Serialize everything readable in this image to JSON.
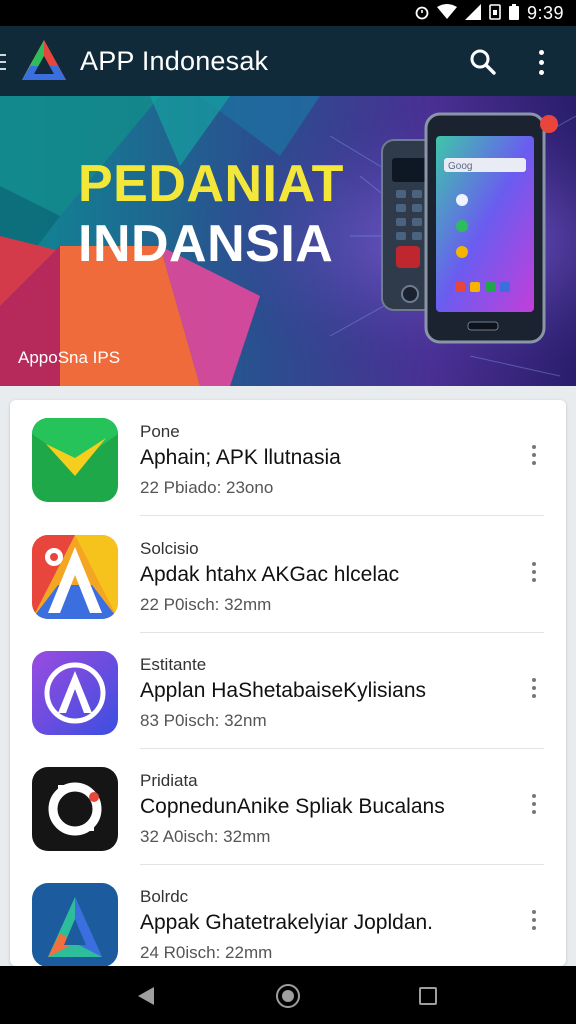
{
  "status_bar": {
    "time": "9:39"
  },
  "app_bar": {
    "title": "APP Indonesak"
  },
  "banner": {
    "headline_line1": "PEDANIAT",
    "headline_line2": "INDANSIA",
    "caption": "AppoSna IPS",
    "phone_screen_label": "Goog"
  },
  "apps": [
    {
      "category": "Pone",
      "title": "Aphain; APK llutnasia",
      "meta": "22 Pbiado: 23ono",
      "icon": "green-check-app-icon",
      "color": "#1ea84a"
    },
    {
      "category": "Solcisio",
      "title": "Apdak htahx AKGac hlcelac",
      "meta": "22 P0isch: 32mm",
      "icon": "colorful-a-app-icon",
      "color": "#e8453c"
    },
    {
      "category": "Estitante",
      "title": "Applan HaShetabaiseKylisians",
      "meta": "83 P0isch: 32nm",
      "icon": "compass-a-app-icon",
      "color": "#5b4bd9"
    },
    {
      "category": "Pridiata",
      "title": "CopnedunAnike Spliak Bucalans",
      "meta": "32 A0isch: 32mm",
      "icon": "camera-ring-app-icon",
      "color": "#151515"
    },
    {
      "category": "Bolrdc",
      "title": "Appak Ghatetrakelyiar Jopldan.",
      "meta": "24 R0isch: 22mm",
      "icon": "blue-a-app-icon",
      "color": "#1d5b9f"
    }
  ],
  "colors": {
    "app_bar": "#102a3a",
    "accent_yellow": "#f3e83a"
  }
}
